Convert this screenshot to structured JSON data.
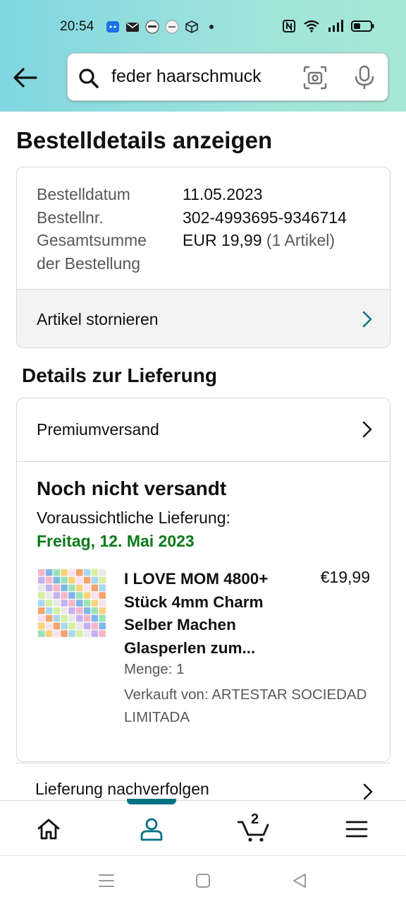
{
  "status_bar": {
    "time": "20:54",
    "left_icons": [
      "android-app-icon",
      "mail-icon",
      "ebay-icon",
      "mifa-icon",
      "box-icon",
      "dot-icon"
    ],
    "right_icons": [
      "nfc-icon",
      "wifi-icon",
      "signal-icon",
      "battery-icon"
    ]
  },
  "search": {
    "query": "feder haarschmuck"
  },
  "page": {
    "title": "Bestelldetails anzeigen"
  },
  "order": {
    "labels": {
      "date": "Bestelldatum",
      "number": "Bestellnr.",
      "total_line1": "Gesamtsumme",
      "total_line2": "der Bestellung"
    },
    "date": "11.05.2023",
    "number": "302-4993695-9346714",
    "total": "EUR 19,99",
    "item_count": "(1 Artikel)",
    "cancel_label": "Artikel stornieren"
  },
  "delivery": {
    "section_title": "Details zur Lieferung",
    "shipping_method": "Premiumversand",
    "status": "Noch nicht versandt",
    "estimate_label": "Voraussichtliche Lieferung:",
    "estimate_date": "Freitag, 12. Mai 2023",
    "track_label": "Lieferung nachverfolgen",
    "colors": {
      "estimate_date": "#0c7a1a"
    }
  },
  "product": {
    "title": "I LOVE MOM 4800+ Stück 4mm Charm Selber Machen Glasperlen zum...",
    "price": "€19,99",
    "quantity": "Menge: 1",
    "seller": "Verkauft von: ARTESTAR SOCIEDAD LIMITADA"
  },
  "bottom_nav": {
    "items": [
      "home-icon",
      "profile-icon",
      "cart-icon",
      "menu-icon"
    ],
    "active": "profile",
    "cart_count": "2",
    "accent": "#007185"
  },
  "system_nav": [
    "recent-apps-icon",
    "home-square-icon",
    "back-triangle-icon"
  ]
}
